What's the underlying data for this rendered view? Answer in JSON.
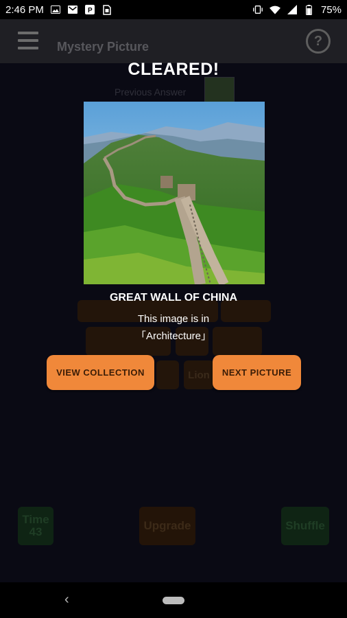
{
  "status_bar": {
    "time": "2:46 PM",
    "battery": "75%",
    "icons": [
      "image-notification-icon",
      "gmail-icon",
      "p-app-icon",
      "sim-icon",
      "vibrate-icon",
      "wifi-icon",
      "signal-icon",
      "battery-icon"
    ]
  },
  "app_bar": {
    "title": "Mystery Picture",
    "help": "?"
  },
  "background": {
    "previous_answer_label": "Previous Answer",
    "time_label": "Time",
    "time_value": "43",
    "upgrade_label": "Upgrade",
    "shuffle_label": "Shuffle",
    "tile_text": "Lion"
  },
  "overlay": {
    "title": "CLEARED!",
    "picture_name": "GREAT WALL OF CHINA",
    "category_line1": "This image is in",
    "category_line2": "「Architecture」",
    "view_collection_label": "VIEW COLLECTION",
    "next_picture_label": "NEXT PICTURE"
  },
  "colors": {
    "accent_button": "#f0883a",
    "background": "#0a0a14"
  }
}
